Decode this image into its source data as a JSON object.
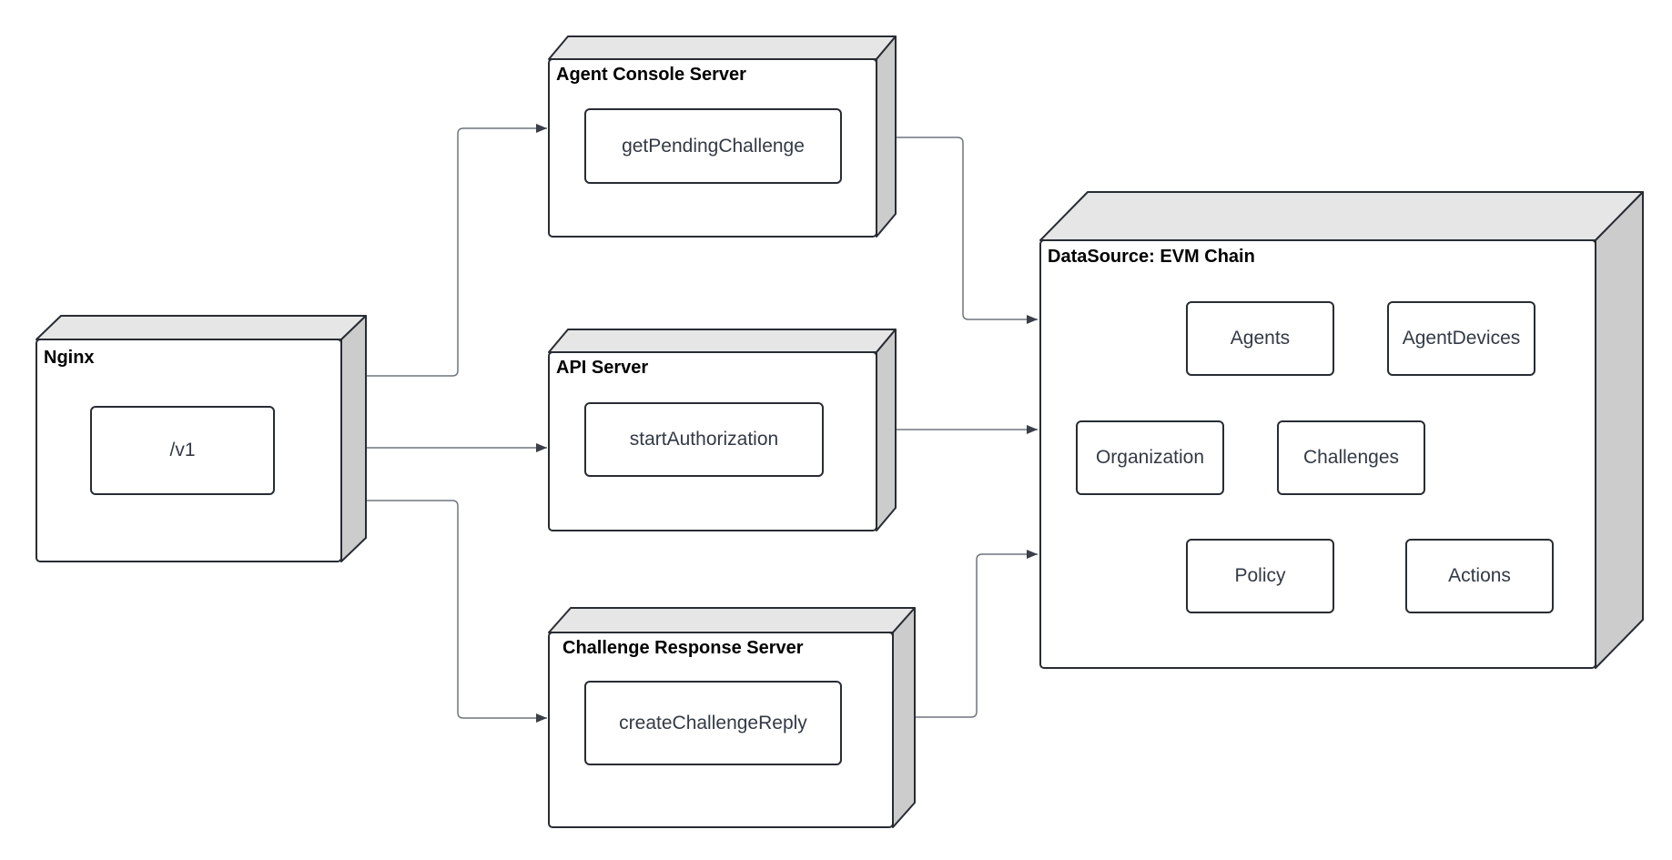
{
  "diagram": {
    "colors": {
      "stroke": "#282c33",
      "top_face": "#e6e6e6",
      "side_face": "#cccccc",
      "connector": "#6f757d",
      "arrow": "#3a3f48",
      "inner_text": "#333a45"
    },
    "nodes": [
      {
        "id": "nginx",
        "title": "Nginx",
        "components": [
          "/v1"
        ]
      },
      {
        "id": "agent-console",
        "title": "Agent Console Server",
        "components": [
          "getPendingChallenge"
        ]
      },
      {
        "id": "api-server",
        "title": "API Server",
        "components": [
          "startAuthorization"
        ]
      },
      {
        "id": "challenge-response",
        "title": "Challenge Response Server",
        "components": [
          "createChallengeReply"
        ]
      },
      {
        "id": "datasource",
        "title": "DataSource: EVM Chain",
        "components": [
          "Agents",
          "AgentDevices",
          "Organization",
          "Challenges",
          "Policy",
          "Actions"
        ]
      }
    ],
    "edges": [
      {
        "from": "nginx",
        "to": "agent-console"
      },
      {
        "from": "nginx",
        "to": "api-server"
      },
      {
        "from": "nginx",
        "to": "challenge-response"
      },
      {
        "from": "agent-console",
        "to": "datasource"
      },
      {
        "from": "api-server",
        "to": "datasource"
      },
      {
        "from": "challenge-response",
        "to": "datasource"
      }
    ]
  }
}
